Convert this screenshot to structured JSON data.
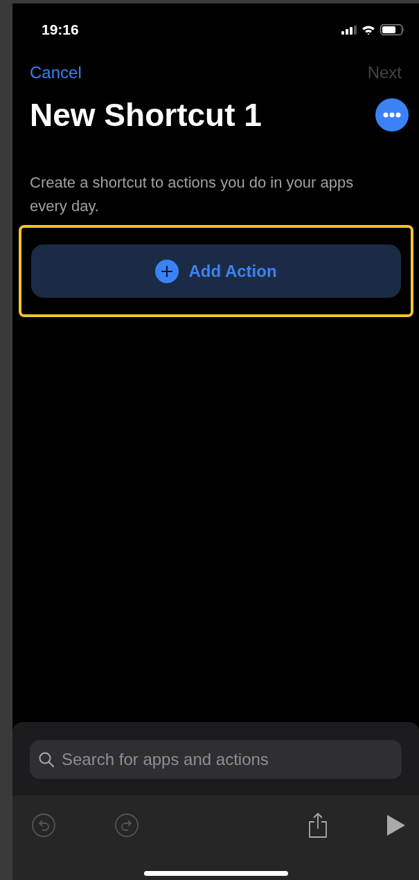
{
  "status_bar": {
    "time": "19:16"
  },
  "nav": {
    "cancel": "Cancel",
    "next": {
      "label": "Next",
      "disabled": true
    }
  },
  "title": "New Shortcut 1",
  "description": "Create a shortcut to actions you do in your apps every day.",
  "add_action": {
    "label": "Add Action",
    "highlighted": true
  },
  "search": {
    "placeholder": "Search for apps and actions"
  },
  "toolbar": [
    {
      "kind": "undo",
      "disabled": true
    },
    {
      "kind": "redo",
      "disabled": true
    },
    {
      "kind": "share",
      "disabled": false
    },
    {
      "kind": "play",
      "disabled": false
    }
  ]
}
